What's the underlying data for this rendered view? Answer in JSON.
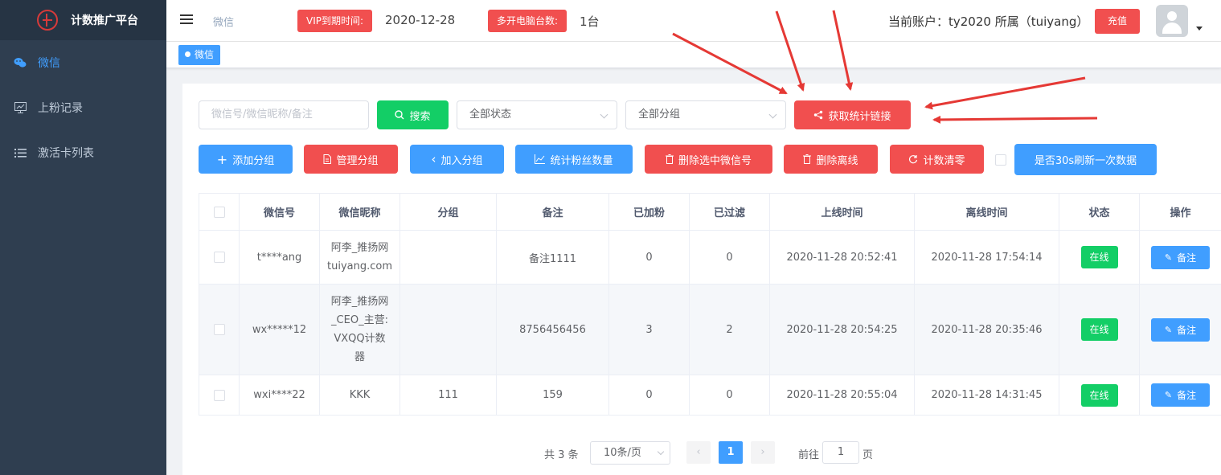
{
  "sidebar": {
    "logo_title": "计数推广平台",
    "items": [
      {
        "label": "微信",
        "icon": "wechat-icon",
        "active": true
      },
      {
        "label": "上粉记录",
        "icon": "chart-monitor-icon",
        "active": false
      },
      {
        "label": "激活卡列表",
        "icon": "list-icon",
        "active": false
      }
    ]
  },
  "header": {
    "breadcrumb": "微信",
    "vip_label": "VIP到期时间:",
    "vip_date": "2020-12-28",
    "multi_label": "多开电脑台数:",
    "multi_count": "1台",
    "account": "当前账户：ty2020 所属（tuiyang）",
    "recharge": "充值"
  },
  "tags": {
    "active": "微信"
  },
  "filters": {
    "search_placeholder": "微信号/微信昵称/备注",
    "search_button": "搜索",
    "status_select": "全部状态",
    "group_select": "全部分组",
    "link_button": "获取统计链接"
  },
  "actions": {
    "add_group": "添加分组",
    "manage_group": "管理分组",
    "join_group": "加入分组",
    "count_fans": "统计粉丝数量",
    "delete_selected": "删除选中微信号",
    "delete_offline": "删除离线",
    "reset_count": "计数清零",
    "refresh_30s": "是否30s刷新一次数据"
  },
  "table": {
    "headers": [
      "微信号",
      "微信昵称",
      "分组",
      "备注",
      "已加粉",
      "已过滤",
      "上线时间",
      "离线时间",
      "状态",
      "操作"
    ],
    "rows": [
      {
        "wxid": "t****ang",
        "nick1": "阿李_推扬网",
        "nick2": "tuiyang.com",
        "nick3": "",
        "nick4": "",
        "group": "",
        "remark": "备注1111",
        "added": "0",
        "filtered": "0",
        "online": "2020-11-28 20:52:41",
        "offline": "2020-11-28 17:54:14",
        "status": "在线",
        "op": "备注"
      },
      {
        "wxid": "wx*****12",
        "nick1": "阿李_推扬网",
        "nick2": "_CEO_主营:",
        "nick3": "VXQQ计数",
        "nick4": "器",
        "group": "",
        "remark": "8756456456",
        "added": "3",
        "filtered": "2",
        "online": "2020-11-28 20:54:25",
        "offline": "2020-11-28 20:35:46",
        "status": "在线",
        "op": "备注"
      },
      {
        "wxid": "wxi****22",
        "nick1": "KKK",
        "nick2": "",
        "nick3": "",
        "nick4": "",
        "group": "111",
        "remark": "159",
        "added": "0",
        "filtered": "0",
        "online": "2020-11-28 20:55:04",
        "offline": "2020-11-28 14:31:45",
        "status": "在线",
        "op": "备注"
      }
    ]
  },
  "pagination": {
    "total": "共 3 条",
    "page_size": "10条/页",
    "prev": "‹",
    "current": "1",
    "next": "›",
    "goto_prefix": "前往",
    "goto_value": "1",
    "goto_suffix": "页"
  },
  "colors": {
    "sidebar_bg": "#2f3e50",
    "primary": "#409eff",
    "danger": "#f14f4f",
    "success": "#13ce66",
    "arrow": "#e53935"
  }
}
